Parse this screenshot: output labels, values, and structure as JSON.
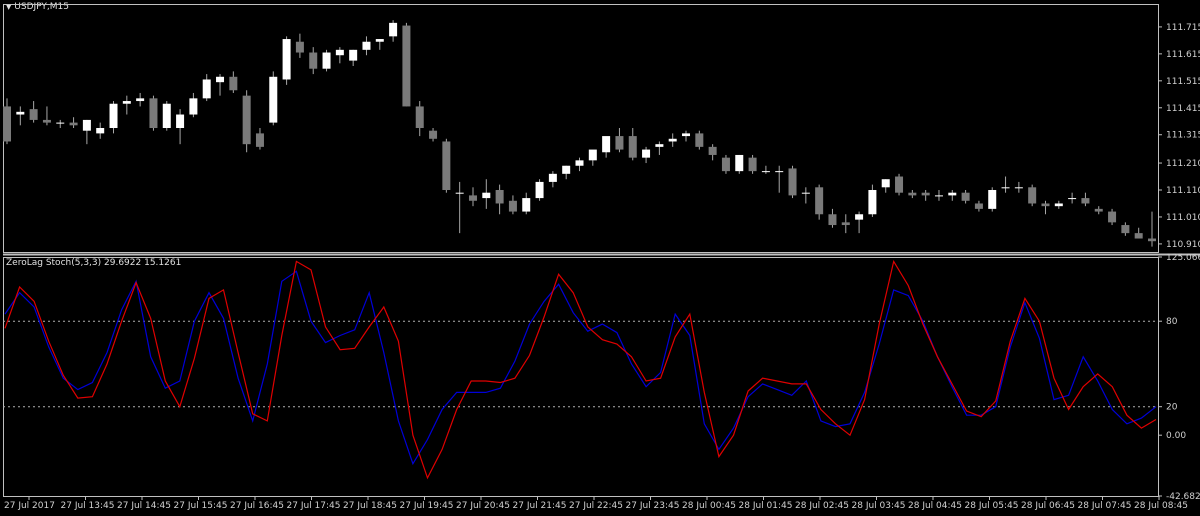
{
  "colors": {
    "background": "#000000",
    "frame": "#c0c0c0",
    "text": "#d0d0d0",
    "bull": "#ffffff",
    "bear": "#7a7a7a",
    "wick": "#a8a8a8",
    "stoch_main": "#0000d8",
    "stoch_signal": "#e00000",
    "level_line": "#b0b0b0"
  },
  "price_panel": {
    "title": "USDJPY,M15",
    "menu_icon": "triangle-down-icon"
  },
  "indicator_panel": {
    "name": "ZeroLag Stoch(5,3,3)",
    "value1": "29.6922",
    "value2": "15.1261"
  },
  "chart_data": [
    {
      "type": "candlestick",
      "symbol": "USDJPY,M15",
      "ylim": [
        110.88,
        111.8
      ],
      "y_ticks": [
        "111.715",
        "111.615",
        "111.515",
        "111.415",
        "111.315",
        "111.210",
        "111.110",
        "111.010",
        "110.910"
      ],
      "candles": [
        [
          111.42,
          111.45,
          111.28,
          111.29
        ],
        [
          111.39,
          111.42,
          111.35,
          111.4
        ],
        [
          111.41,
          111.44,
          111.36,
          111.37
        ],
        [
          111.37,
          111.42,
          111.35,
          111.36
        ],
        [
          111.36,
          111.37,
          111.34,
          111.36
        ],
        [
          111.36,
          111.38,
          111.34,
          111.35
        ],
        [
          111.33,
          111.37,
          111.28,
          111.37
        ],
        [
          111.32,
          111.36,
          111.3,
          111.34
        ],
        [
          111.34,
          111.44,
          111.32,
          111.43
        ],
        [
          111.43,
          111.46,
          111.39,
          111.44
        ],
        [
          111.44,
          111.47,
          111.42,
          111.45
        ],
        [
          111.45,
          111.46,
          111.33,
          111.34
        ],
        [
          111.34,
          111.44,
          111.33,
          111.43
        ],
        [
          111.34,
          111.41,
          111.28,
          111.39
        ],
        [
          111.39,
          111.47,
          111.38,
          111.45
        ],
        [
          111.45,
          111.54,
          111.44,
          111.52
        ],
        [
          111.51,
          111.54,
          111.46,
          111.53
        ],
        [
          111.53,
          111.55,
          111.47,
          111.48
        ],
        [
          111.46,
          111.48,
          111.25,
          111.28
        ],
        [
          111.32,
          111.34,
          111.26,
          111.27
        ],
        [
          111.36,
          111.55,
          111.35,
          111.53
        ],
        [
          111.52,
          111.68,
          111.5,
          111.67
        ],
        [
          111.66,
          111.69,
          111.6,
          111.62
        ],
        [
          111.62,
          111.64,
          111.54,
          111.56
        ],
        [
          111.56,
          111.63,
          111.55,
          111.62
        ],
        [
          111.61,
          111.64,
          111.58,
          111.63
        ],
        [
          111.59,
          111.63,
          111.57,
          111.63
        ],
        [
          111.63,
          111.68,
          111.61,
          111.66
        ],
        [
          111.66,
          111.67,
          111.63,
          111.67
        ],
        [
          111.68,
          111.74,
          111.66,
          111.73
        ],
        [
          111.72,
          111.73,
          111.42,
          111.42
        ],
        [
          111.42,
          111.44,
          111.31,
          111.34
        ],
        [
          111.33,
          111.34,
          111.29,
          111.3
        ],
        [
          111.29,
          111.3,
          111.1,
          111.11
        ],
        [
          111.1,
          111.14,
          110.95,
          111.1
        ],
        [
          111.09,
          111.12,
          111.05,
          111.07
        ],
        [
          111.08,
          111.15,
          111.04,
          111.1
        ],
        [
          111.11,
          111.13,
          111.02,
          111.06
        ],
        [
          111.07,
          111.09,
          111.02,
          111.03
        ],
        [
          111.03,
          111.1,
          111.02,
          111.08
        ],
        [
          111.08,
          111.15,
          111.07,
          111.14
        ],
        [
          111.14,
          111.18,
          111.12,
          111.17
        ],
        [
          111.17,
          111.2,
          111.15,
          111.2
        ],
        [
          111.2,
          111.23,
          111.18,
          111.22
        ],
        [
          111.22,
          111.25,
          111.2,
          111.26
        ],
        [
          111.25,
          111.29,
          111.23,
          111.31
        ],
        [
          111.31,
          111.34,
          111.25,
          111.26
        ],
        [
          111.31,
          111.34,
          111.22,
          111.23
        ],
        [
          111.23,
          111.27,
          111.21,
          111.26
        ],
        [
          111.27,
          111.29,
          111.24,
          111.28
        ],
        [
          111.29,
          111.32,
          111.27,
          111.3
        ],
        [
          111.31,
          111.33,
          111.29,
          111.32
        ],
        [
          111.32,
          111.33,
          111.26,
          111.27
        ],
        [
          111.27,
          111.28,
          111.22,
          111.24
        ],
        [
          111.23,
          111.24,
          111.17,
          111.18
        ],
        [
          111.18,
          111.24,
          111.17,
          111.24
        ],
        [
          111.23,
          111.24,
          111.17,
          111.18
        ],
        [
          111.18,
          111.2,
          111.17,
          111.18
        ],
        [
          111.18,
          111.2,
          111.1,
          111.18
        ],
        [
          111.19,
          111.2,
          111.08,
          111.09
        ],
        [
          111.1,
          111.12,
          111.06,
          111.1
        ],
        [
          111.12,
          111.13,
          111.0,
          111.02
        ],
        [
          111.02,
          111.04,
          110.97,
          110.98
        ],
        [
          110.99,
          111.02,
          110.95,
          110.98
        ],
        [
          111.0,
          111.03,
          110.95,
          111.02
        ],
        [
          111.02,
          111.13,
          111.01,
          111.11
        ],
        [
          111.12,
          111.15,
          111.1,
          111.15
        ],
        [
          111.16,
          111.17,
          111.09,
          111.1
        ],
        [
          111.1,
          111.11,
          111.08,
          111.09
        ],
        [
          111.1,
          111.11,
          111.07,
          111.09
        ],
        [
          111.09,
          111.11,
          111.07,
          111.09
        ],
        [
          111.09,
          111.11,
          111.07,
          111.1
        ],
        [
          111.1,
          111.11,
          111.06,
          111.07
        ],
        [
          111.06,
          111.07,
          111.03,
          111.04
        ],
        [
          111.04,
          111.12,
          111.03,
          111.11
        ],
        [
          111.12,
          111.16,
          111.1,
          111.12
        ],
        [
          111.12,
          111.14,
          111.1,
          111.12
        ],
        [
          111.12,
          111.13,
          111.05,
          111.06
        ],
        [
          111.06,
          111.07,
          111.02,
          111.05
        ],
        [
          111.05,
          111.07,
          111.04,
          111.06
        ],
        [
          111.08,
          111.1,
          111.06,
          111.08
        ],
        [
          111.08,
          111.1,
          111.05,
          111.06
        ],
        [
          111.04,
          111.05,
          111.02,
          111.03
        ],
        [
          111.03,
          111.04,
          110.98,
          110.99
        ],
        [
          110.98,
          110.99,
          110.94,
          110.95
        ],
        [
          110.95,
          110.97,
          110.93,
          110.93
        ],
        [
          110.93,
          111.03,
          110.9,
          110.92
        ]
      ]
    },
    {
      "type": "line",
      "title": "ZeroLag Stoch(5,3,3)",
      "ylim": [
        -42.6829,
        125.0668
      ],
      "y_ticks": [
        "125.0668",
        "80",
        "20",
        "0.00",
        "-42.6829"
      ],
      "levels": [
        80,
        20
      ],
      "x_tick_labels": [
        "27 Jul 2017",
        "27 Jul 13:45",
        "27 Jul 14:45",
        "27 Jul 15:45",
        "27 Jul 16:45",
        "27 Jul 17:45",
        "27 Jul 18:45",
        "27 Jul 19:45",
        "27 Jul 20:45",
        "27 Jul 21:45",
        "27 Jul 22:45",
        "27 Jul 23:45",
        "28 Jul 00:45",
        "28 Jul 01:45",
        "28 Jul 02:45",
        "28 Jul 03:45",
        "28 Jul 04:45",
        "28 Jul 05:45",
        "28 Jul 06:45",
        "28 Jul 07:45",
        "28 Jul 08:45"
      ],
      "series": [
        {
          "color": "#0000d8",
          "values": [
            85,
            100,
            90,
            62,
            40,
            32,
            37,
            58,
            88,
            108,
            55,
            33,
            38,
            80,
            100,
            82,
            40,
            10,
            50,
            108,
            115,
            80,
            65,
            70,
            74,
            100,
            58,
            10,
            -20,
            -3,
            18,
            30,
            30,
            30,
            33,
            52,
            78,
            94,
            106,
            86,
            73,
            78,
            72,
            50,
            34,
            44,
            85,
            70,
            8,
            -10,
            5,
            27,
            36,
            32,
            28,
            38,
            10,
            6,
            8,
            30,
            64,
            102,
            98,
            80,
            55,
            34,
            14,
            14,
            20,
            62,
            93,
            68,
            25,
            28,
            55,
            38,
            18,
            8,
            12,
            20
          ],
          "line_width": 1.2
        },
        {
          "color": "#e00000",
          "values": [
            75,
            104,
            94,
            66,
            42,
            26,
            27,
            50,
            80,
            107,
            82,
            38,
            20,
            54,
            96,
            102,
            58,
            15,
            10,
            70,
            122,
            116,
            76,
            60,
            61,
            76,
            90,
            66,
            0,
            -30,
            -10,
            18,
            38,
            38,
            37,
            40,
            56,
            83,
            113,
            100,
            76,
            67,
            64,
            55,
            38,
            40,
            69,
            85,
            30,
            -15,
            0,
            31,
            40,
            38,
            36,
            36,
            18,
            8,
            0,
            25,
            78,
            122,
            105,
            78,
            55,
            36,
            17,
            13,
            24,
            66,
            96,
            80,
            40,
            18,
            34,
            43,
            34,
            14,
            5,
            11
          ],
          "line_width": 1.2
        }
      ]
    }
  ]
}
